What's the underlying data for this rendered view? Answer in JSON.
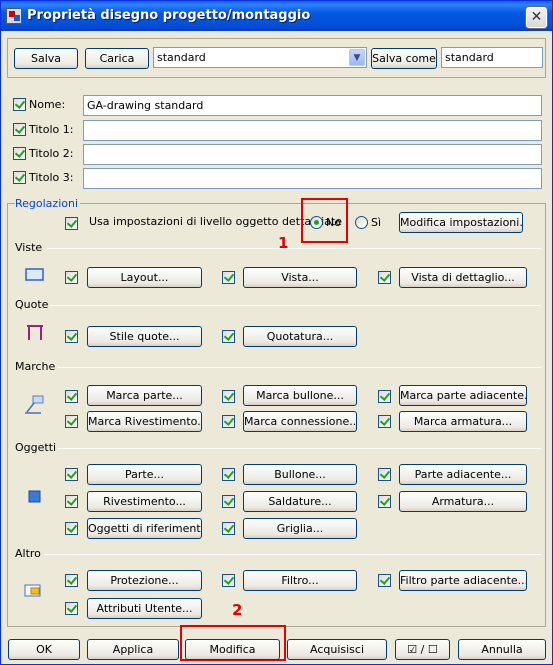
{
  "window": {
    "title": "Proprietà disegno progetto/montaggio",
    "close": "✕"
  },
  "toolbar": {
    "save": "Salva",
    "load": "Carica",
    "preset": "standard",
    "save_as": "Salva come",
    "save_as_name": "standard"
  },
  "name_fields": {
    "name_label": "Nome:",
    "name_value": "GA-drawing standard",
    "title1_label": "Titolo 1:",
    "title1_value": "",
    "title2_label": "Titolo 2:",
    "title2_value": "",
    "title3_label": "Titolo 3:",
    "title3_value": ""
  },
  "settings": {
    "group_label": "Regolazioni",
    "use_detail_label": "Usa impostazioni di livello oggetto dettagliate",
    "radio_no": "No",
    "radio_yes": "Sì",
    "modify_settings": "Modifica impostazioni..."
  },
  "sections": {
    "views": {
      "label": "Viste",
      "buttons": [
        "Layout...",
        "Vista...",
        "Vista di dettaglio..."
      ]
    },
    "dimensions": {
      "label": "Quote",
      "buttons": [
        "Stile quote...",
        "Quotatura..."
      ]
    },
    "marks": {
      "label": "Marche",
      "buttons": [
        "Marca parte...",
        "Marca bullone...",
        "Marca parte adiacente...",
        "Marca Rivestimento...",
        "Marca connessione...",
        "Marca armatura..."
      ]
    },
    "objects": {
      "label": "Oggetti",
      "buttons": [
        "Parte...",
        "Bullone...",
        "Parte adiacente...",
        "Rivestimento...",
        "Saldature...",
        "Armatura...",
        "Oggetti di riferimento...",
        "Griglia..."
      ]
    },
    "other": {
      "label": "Altro",
      "buttons": [
        "Protezione...",
        "Filtro...",
        "Filtro parte adiacente...",
        "Attributi Utente..."
      ]
    }
  },
  "annotations": {
    "marker1": "1",
    "marker2": "2",
    "accent": "#e60000"
  },
  "footer": {
    "ok": "OK",
    "apply": "Applica",
    "modify": "Modifica",
    "acquire": "Acquisisci",
    "toggle": "☑ / ☐",
    "cancel": "Annulla"
  }
}
